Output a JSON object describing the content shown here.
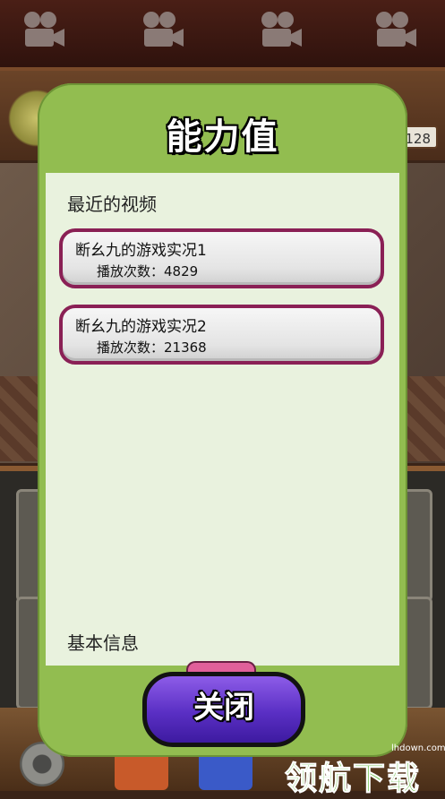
{
  "background": {
    "counter_text": ",128"
  },
  "modal": {
    "title": "能力值",
    "recent_videos_label": "最近的视频",
    "videos": [
      {
        "title": "断幺九的游戏实况1",
        "plays": "播放次数：4829"
      },
      {
        "title": "断幺九的游戏实况2",
        "plays": "播放次数：21368"
      }
    ],
    "basic_info_label": "基本信息",
    "close_label": "关闭"
  },
  "watermark": {
    "text": "领航下载",
    "site": "lhdown.com"
  }
}
